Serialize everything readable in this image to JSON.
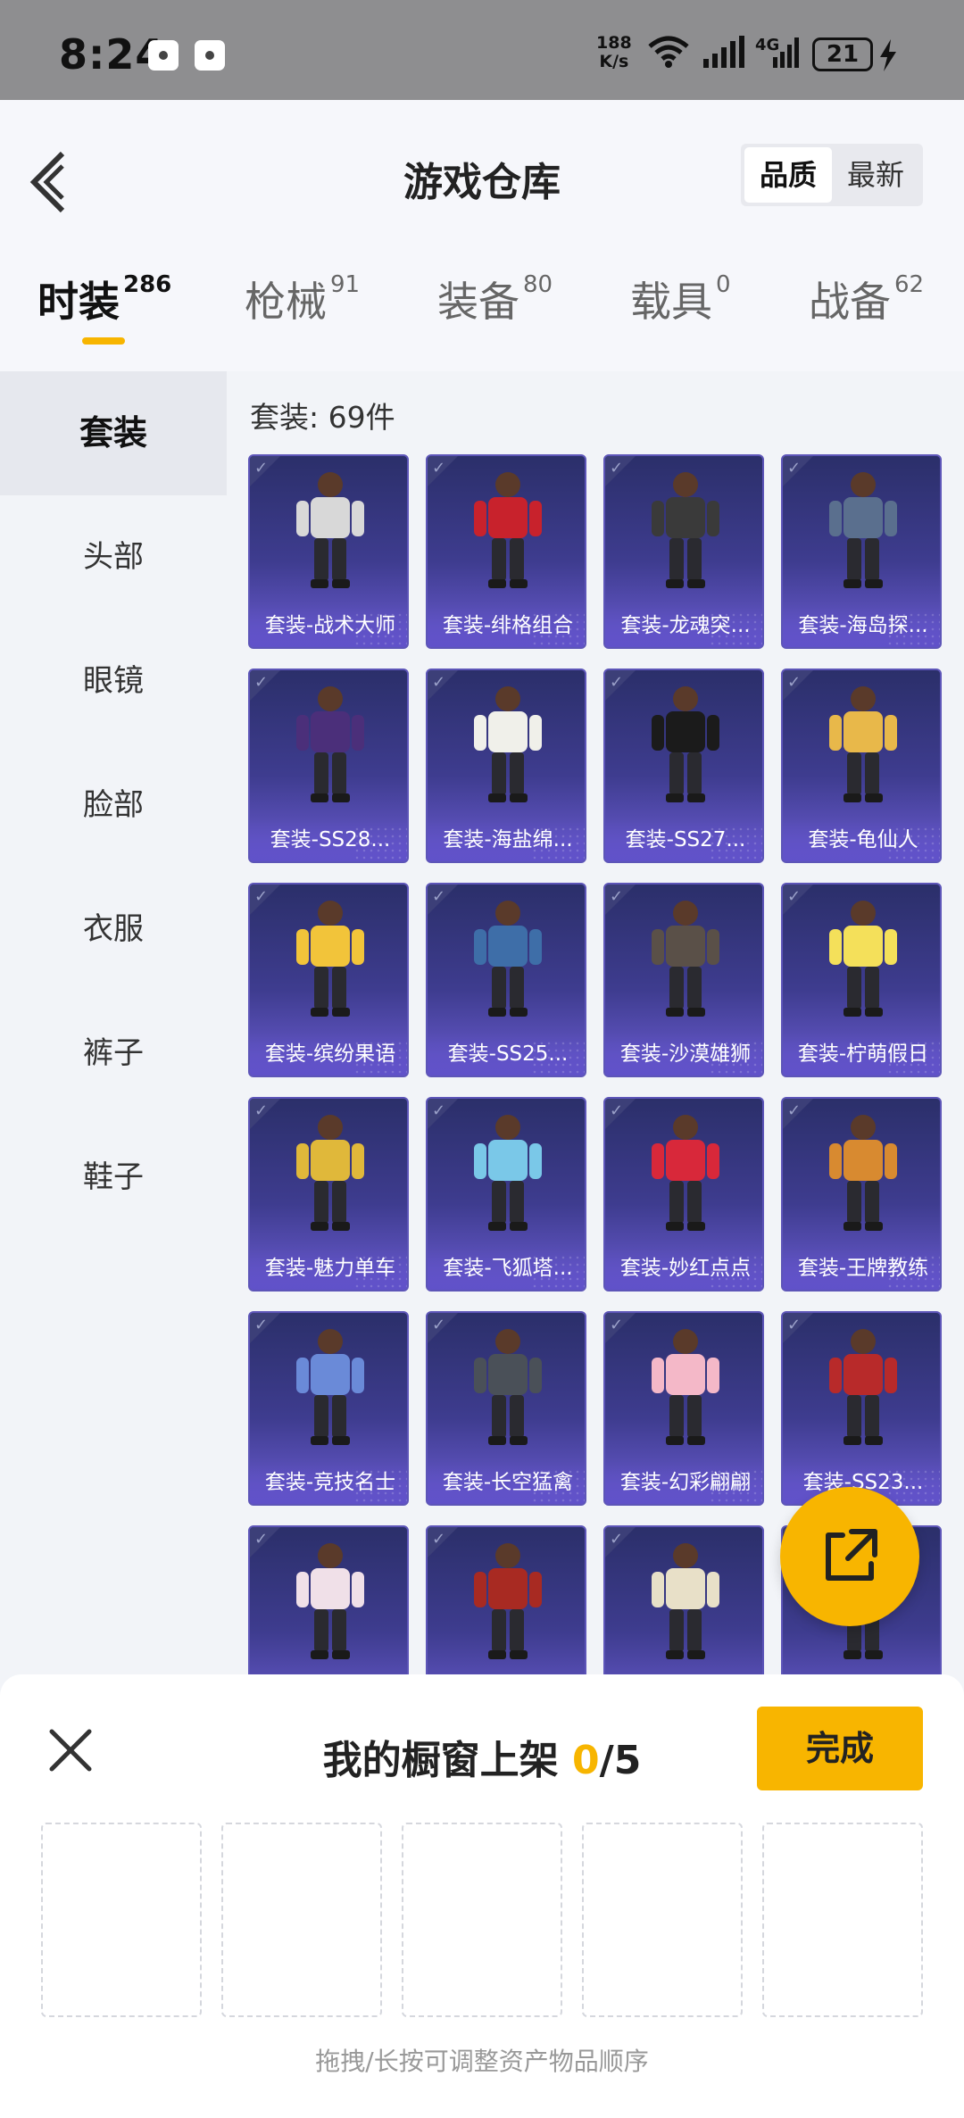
{
  "status_bar": {
    "time": "8:24",
    "speed_value": "188",
    "speed_unit": "K/s",
    "battery": "21"
  },
  "header": {
    "title": "游戏仓库",
    "sort_options": [
      "品质",
      "最新"
    ],
    "active_sort": "品质"
  },
  "tabs": [
    {
      "label": "时装",
      "count": "286"
    },
    {
      "label": "枪械",
      "count": "91"
    },
    {
      "label": "装备",
      "count": "80"
    },
    {
      "label": "载具",
      "count": "0"
    },
    {
      "label": "战备",
      "count": "62"
    }
  ],
  "sidebar": {
    "items": [
      "套装",
      "头部",
      "眼镜",
      "脸部",
      "衣服",
      "裤子",
      "鞋子"
    ],
    "active": "套装"
  },
  "content": {
    "count_label": "套装: 69件",
    "items": [
      {
        "name": "套装-战术大师"
      },
      {
        "name": "套装-绯格组合"
      },
      {
        "name": "套装-龙魂突..."
      },
      {
        "name": "套装-海岛探..."
      },
      {
        "name": "套装-SS28..."
      },
      {
        "name": "套装-海盐绵..."
      },
      {
        "name": "套装-SS27..."
      },
      {
        "name": "套装-龟仙人"
      },
      {
        "name": "套装-缤纷果语"
      },
      {
        "name": "套装-SS25..."
      },
      {
        "name": "套装-沙漠雄狮"
      },
      {
        "name": "套装-柠萌假日"
      },
      {
        "name": "套装-魅力单车"
      },
      {
        "name": "套装-飞狐塔..."
      },
      {
        "name": "套装-妙红点点"
      },
      {
        "name": "套装-王牌教练"
      },
      {
        "name": "套装-竞技名士"
      },
      {
        "name": "套装-长空猛禽"
      },
      {
        "name": "套装-幻彩翩翩"
      },
      {
        "name": "套装-SS23..."
      },
      {
        "name": ""
      },
      {
        "name": ""
      },
      {
        "name": ""
      },
      {
        "name": ""
      }
    ]
  },
  "showcase": {
    "title": "我的橱窗上架",
    "current": "0",
    "separator_total": "/5",
    "done_label": "完成",
    "hint": "拖拽/长按可调整资产物品顺序"
  },
  "colors": {
    "accent": "#f8b500",
    "card_bg": "#3e3c8f"
  }
}
